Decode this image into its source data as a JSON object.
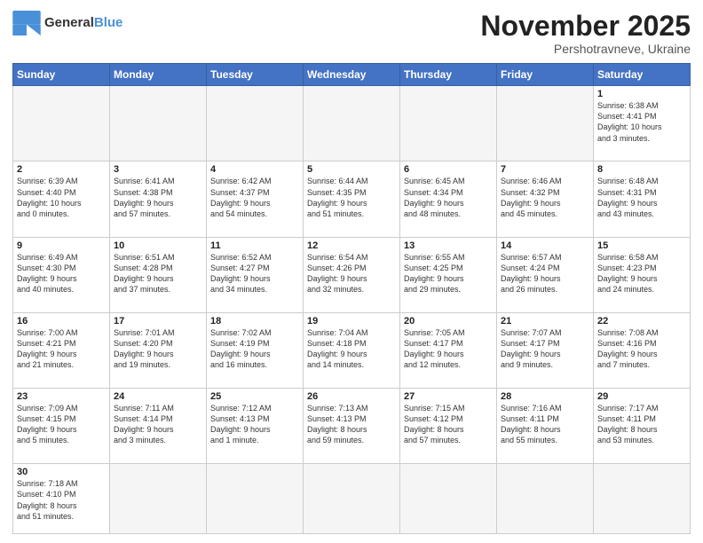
{
  "logo": {
    "text_general": "General",
    "text_blue": "Blue"
  },
  "header": {
    "month": "November 2025",
    "location": "Pershotravneve, Ukraine"
  },
  "weekdays": [
    "Sunday",
    "Monday",
    "Tuesday",
    "Wednesday",
    "Thursday",
    "Friday",
    "Saturday"
  ],
  "weeks": [
    [
      {
        "day": null,
        "info": null
      },
      {
        "day": null,
        "info": null
      },
      {
        "day": null,
        "info": null
      },
      {
        "day": null,
        "info": null
      },
      {
        "day": null,
        "info": null
      },
      {
        "day": null,
        "info": null
      },
      {
        "day": "1",
        "info": "Sunrise: 6:38 AM\nSunset: 4:41 PM\nDaylight: 10 hours\nand 3 minutes."
      }
    ],
    [
      {
        "day": "2",
        "info": "Sunrise: 6:39 AM\nSunset: 4:40 PM\nDaylight: 10 hours\nand 0 minutes."
      },
      {
        "day": "3",
        "info": "Sunrise: 6:41 AM\nSunset: 4:38 PM\nDaylight: 9 hours\nand 57 minutes."
      },
      {
        "day": "4",
        "info": "Sunrise: 6:42 AM\nSunset: 4:37 PM\nDaylight: 9 hours\nand 54 minutes."
      },
      {
        "day": "5",
        "info": "Sunrise: 6:44 AM\nSunset: 4:35 PM\nDaylight: 9 hours\nand 51 minutes."
      },
      {
        "day": "6",
        "info": "Sunrise: 6:45 AM\nSunset: 4:34 PM\nDaylight: 9 hours\nand 48 minutes."
      },
      {
        "day": "7",
        "info": "Sunrise: 6:46 AM\nSunset: 4:32 PM\nDaylight: 9 hours\nand 45 minutes."
      },
      {
        "day": "8",
        "info": "Sunrise: 6:48 AM\nSunset: 4:31 PM\nDaylight: 9 hours\nand 43 minutes."
      }
    ],
    [
      {
        "day": "9",
        "info": "Sunrise: 6:49 AM\nSunset: 4:30 PM\nDaylight: 9 hours\nand 40 minutes."
      },
      {
        "day": "10",
        "info": "Sunrise: 6:51 AM\nSunset: 4:28 PM\nDaylight: 9 hours\nand 37 minutes."
      },
      {
        "day": "11",
        "info": "Sunrise: 6:52 AM\nSunset: 4:27 PM\nDaylight: 9 hours\nand 34 minutes."
      },
      {
        "day": "12",
        "info": "Sunrise: 6:54 AM\nSunset: 4:26 PM\nDaylight: 9 hours\nand 32 minutes."
      },
      {
        "day": "13",
        "info": "Sunrise: 6:55 AM\nSunset: 4:25 PM\nDaylight: 9 hours\nand 29 minutes."
      },
      {
        "day": "14",
        "info": "Sunrise: 6:57 AM\nSunset: 4:24 PM\nDaylight: 9 hours\nand 26 minutes."
      },
      {
        "day": "15",
        "info": "Sunrise: 6:58 AM\nSunset: 4:23 PM\nDaylight: 9 hours\nand 24 minutes."
      }
    ],
    [
      {
        "day": "16",
        "info": "Sunrise: 7:00 AM\nSunset: 4:21 PM\nDaylight: 9 hours\nand 21 minutes."
      },
      {
        "day": "17",
        "info": "Sunrise: 7:01 AM\nSunset: 4:20 PM\nDaylight: 9 hours\nand 19 minutes."
      },
      {
        "day": "18",
        "info": "Sunrise: 7:02 AM\nSunset: 4:19 PM\nDaylight: 9 hours\nand 16 minutes."
      },
      {
        "day": "19",
        "info": "Sunrise: 7:04 AM\nSunset: 4:18 PM\nDaylight: 9 hours\nand 14 minutes."
      },
      {
        "day": "20",
        "info": "Sunrise: 7:05 AM\nSunset: 4:17 PM\nDaylight: 9 hours\nand 12 minutes."
      },
      {
        "day": "21",
        "info": "Sunrise: 7:07 AM\nSunset: 4:17 PM\nDaylight: 9 hours\nand 9 minutes."
      },
      {
        "day": "22",
        "info": "Sunrise: 7:08 AM\nSunset: 4:16 PM\nDaylight: 9 hours\nand 7 minutes."
      }
    ],
    [
      {
        "day": "23",
        "info": "Sunrise: 7:09 AM\nSunset: 4:15 PM\nDaylight: 9 hours\nand 5 minutes."
      },
      {
        "day": "24",
        "info": "Sunrise: 7:11 AM\nSunset: 4:14 PM\nDaylight: 9 hours\nand 3 minutes."
      },
      {
        "day": "25",
        "info": "Sunrise: 7:12 AM\nSunset: 4:13 PM\nDaylight: 9 hours\nand 1 minute."
      },
      {
        "day": "26",
        "info": "Sunrise: 7:13 AM\nSunset: 4:13 PM\nDaylight: 8 hours\nand 59 minutes."
      },
      {
        "day": "27",
        "info": "Sunrise: 7:15 AM\nSunset: 4:12 PM\nDaylight: 8 hours\nand 57 minutes."
      },
      {
        "day": "28",
        "info": "Sunrise: 7:16 AM\nSunset: 4:11 PM\nDaylight: 8 hours\nand 55 minutes."
      },
      {
        "day": "29",
        "info": "Sunrise: 7:17 AM\nSunset: 4:11 PM\nDaylight: 8 hours\nand 53 minutes."
      }
    ],
    [
      {
        "day": "30",
        "info": "Sunrise: 7:18 AM\nSunset: 4:10 PM\nDaylight: 8 hours\nand 51 minutes."
      },
      {
        "day": null,
        "info": null
      },
      {
        "day": null,
        "info": null
      },
      {
        "day": null,
        "info": null
      },
      {
        "day": null,
        "info": null
      },
      {
        "day": null,
        "info": null
      },
      {
        "day": null,
        "info": null
      }
    ]
  ]
}
